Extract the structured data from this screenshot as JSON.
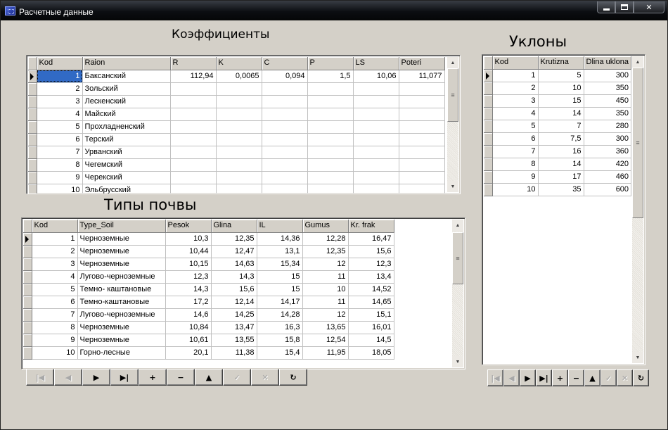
{
  "window": {
    "title": "Расчетные данные",
    "icon": "database-icon",
    "controls": {
      "minimize": "minimize-icon",
      "maximize": "maximize-icon",
      "close": "✕"
    }
  },
  "headings": {
    "coefficients": "Коэффициенты",
    "slopes": "Уклоны",
    "soil_types": "Типы почвы"
  },
  "coefficients_table": {
    "columns": [
      "Kod",
      "Raion",
      "R",
      "K",
      "C",
      "P",
      "LS",
      "Poteri"
    ],
    "rows": [
      [
        "1",
        "Баксанский",
        "112,94",
        "0,0065",
        "0,094",
        "1,5",
        "10,06",
        "11,077"
      ],
      [
        "2",
        "Зольский",
        "",
        "",
        "",
        "",
        "",
        ""
      ],
      [
        "3",
        "Лескенский",
        "",
        "",
        "",
        "",
        "",
        ""
      ],
      [
        "4",
        "Майский",
        "",
        "",
        "",
        "",
        "",
        ""
      ],
      [
        "5",
        "Прохладненский",
        "",
        "",
        "",
        "",
        "",
        ""
      ],
      [
        "6",
        "Терский",
        "",
        "",
        "",
        "",
        "",
        ""
      ],
      [
        "7",
        "Урванский",
        "",
        "",
        "",
        "",
        "",
        ""
      ],
      [
        "8",
        "Чегемский",
        "",
        "",
        "",
        "",
        "",
        ""
      ],
      [
        "9",
        "Черекский",
        "",
        "",
        "",
        "",
        "",
        ""
      ],
      [
        "10",
        "Эльбрусский",
        "",
        "",
        "",
        "",
        "",
        ""
      ]
    ],
    "current_row": 0
  },
  "soil_table": {
    "columns": [
      "Kod",
      "Type_Soil",
      "Pesok",
      "Glina",
      "IL",
      "Gumus",
      "Kr. frak"
    ],
    "rows": [
      [
        "1",
        "Черноземные",
        "10,3",
        "12,35",
        "14,36",
        "12,28",
        "16,47"
      ],
      [
        "2",
        "Черноземные",
        "10,44",
        "12,47",
        "13,1",
        "12,35",
        "15,6"
      ],
      [
        "3",
        "Черноземные",
        "10,15",
        "14,63",
        "15,34",
        "12",
        "12,3"
      ],
      [
        "4",
        "Лугово-черноземные",
        "12,3",
        "14,3",
        "15",
        "11",
        "13,4"
      ],
      [
        "5",
        "Темно- каштановые",
        "14,3",
        "15,6",
        "15",
        "10",
        "14,52"
      ],
      [
        "6",
        "Темно-каштановые",
        "17,2",
        "12,14",
        "14,17",
        "11",
        "14,65"
      ],
      [
        "7",
        "Лугово-черноземные",
        "14,6",
        "14,25",
        "14,28",
        "12",
        "15,1"
      ],
      [
        "8",
        "Черноземные",
        "10,84",
        "13,47",
        "16,3",
        "13,65",
        "16,01"
      ],
      [
        "9",
        "Черноземные",
        "10,61",
        "13,55",
        "15,8",
        "12,54",
        "14,5"
      ],
      [
        "10",
        "Горно-лесные",
        "20,1",
        "11,38",
        "15,4",
        "11,95",
        "18,05"
      ]
    ],
    "current_row": 0
  },
  "slopes_table": {
    "columns": [
      "Kod",
      "Krutizna",
      "Dlina uklona"
    ],
    "rows": [
      [
        "1",
        "5",
        "300"
      ],
      [
        "2",
        "10",
        "350"
      ],
      [
        "3",
        "15",
        "450"
      ],
      [
        "4",
        "14",
        "350"
      ],
      [
        "5",
        "7",
        "280"
      ],
      [
        "6",
        "7,5",
        "300"
      ],
      [
        "7",
        "16",
        "360"
      ],
      [
        "8",
        "14",
        "420"
      ],
      [
        "9",
        "17",
        "460"
      ],
      [
        "10",
        "35",
        "600"
      ]
    ],
    "current_row": 0
  },
  "navigator": {
    "buttons": [
      {
        "name": "first",
        "icon": "first-record-icon",
        "glyph": "|◀",
        "enabled": false
      },
      {
        "name": "prior",
        "icon": "prior-record-icon",
        "glyph": "◀",
        "enabled": false
      },
      {
        "name": "next",
        "icon": "next-record-icon",
        "glyph": "▶",
        "enabled": true
      },
      {
        "name": "last",
        "icon": "last-record-icon",
        "glyph": "▶|",
        "enabled": true
      },
      {
        "name": "insert",
        "icon": "insert-record-icon",
        "glyph": "+",
        "enabled": true
      },
      {
        "name": "delete",
        "icon": "delete-record-icon",
        "glyph": "−",
        "enabled": true
      },
      {
        "name": "edit",
        "icon": "edit-record-icon",
        "glyph": "▲",
        "enabled": true
      },
      {
        "name": "post",
        "icon": "post-record-icon",
        "glyph": "✓",
        "enabled": false
      },
      {
        "name": "cancel",
        "icon": "cancel-record-icon",
        "glyph": "✕",
        "enabled": false
      },
      {
        "name": "refresh",
        "icon": "refresh-icon",
        "glyph": "↻",
        "enabled": true
      }
    ]
  },
  "colors": {
    "face": "#d4d0c8",
    "selection": "#316ac5",
    "titlebar": "#0c0e12"
  }
}
